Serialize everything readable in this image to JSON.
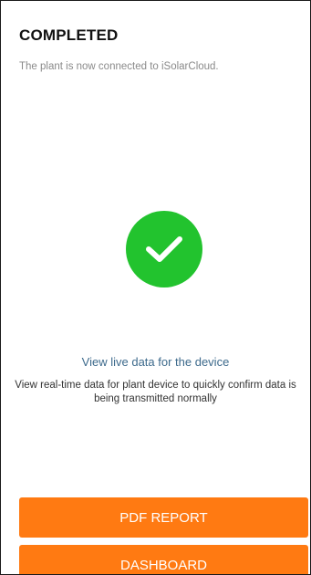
{
  "header": {
    "title": "COMPLETED",
    "subtitle": "The plant is now connected to iSolarCloud."
  },
  "status": {
    "icon": "check-circle-icon",
    "color": "#22c32e"
  },
  "main": {
    "live_link": "View live data for the device",
    "description": "View real-time data for plant device to quickly confirm data is being transmitted normally"
  },
  "actions": {
    "pdf_report_label": "PDF REPORT",
    "dashboard_label": "DASHBOARD",
    "button_color": "#ff7a12"
  }
}
